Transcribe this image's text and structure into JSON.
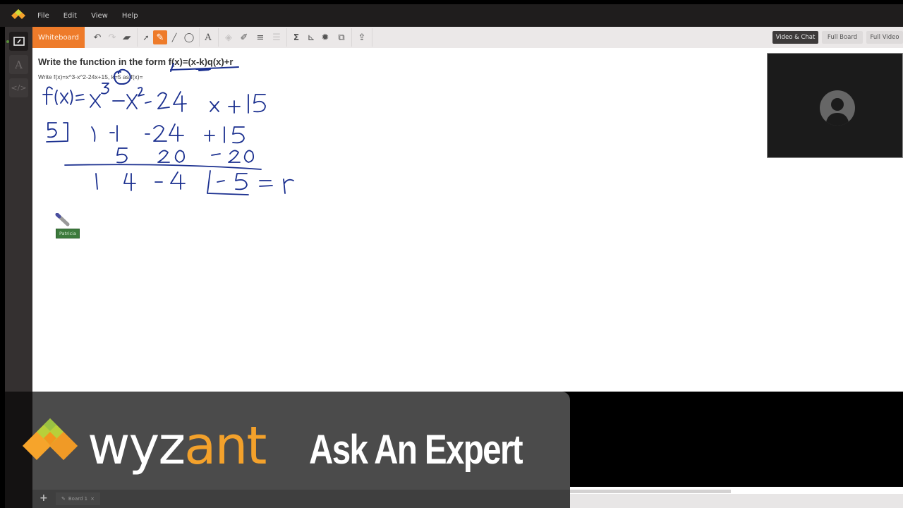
{
  "menu": {
    "items": [
      "File",
      "Edit",
      "View",
      "Help"
    ]
  },
  "toolbar": {
    "active_tab": "Whiteboard",
    "tools": [
      {
        "name": "undo-icon",
        "glyph": "↶",
        "state": "normal"
      },
      {
        "name": "redo-icon",
        "glyph": "↷",
        "state": "disabled"
      },
      {
        "name": "eraser-icon",
        "glyph": "▰",
        "state": "normal"
      },
      {
        "name": "select-icon",
        "glyph": "➚",
        "state": "normal"
      },
      {
        "name": "pen-icon",
        "glyph": "✎",
        "state": "active"
      },
      {
        "name": "line-icon",
        "glyph": "╱",
        "state": "normal"
      },
      {
        "name": "shape-icon",
        "glyph": "◯",
        "state": "normal"
      },
      {
        "name": "text-icon",
        "glyph": "A",
        "state": "normal"
      },
      {
        "name": "fill-icon",
        "glyph": "◈",
        "state": "disabled"
      },
      {
        "name": "color-icon",
        "glyph": "✐",
        "state": "normal"
      },
      {
        "name": "line-weight-icon",
        "glyph": "≡",
        "state": "normal"
      },
      {
        "name": "line-style-icon",
        "glyph": "☰",
        "state": "disabled"
      },
      {
        "name": "equation-icon",
        "glyph": "Σ",
        "state": "normal"
      },
      {
        "name": "graph-icon",
        "glyph": "⊾",
        "state": "normal"
      },
      {
        "name": "settings-icon",
        "glyph": "✹",
        "state": "normal"
      },
      {
        "name": "layers-icon",
        "glyph": "⧉",
        "state": "normal"
      },
      {
        "name": "upload-icon",
        "glyph": "⇪",
        "state": "normal"
      }
    ],
    "view_buttons": [
      {
        "label": "Video & Chat",
        "active": true
      },
      {
        "label": "Full Board",
        "active": false
      },
      {
        "label": "Full Video",
        "active": false
      }
    ]
  },
  "left_rail": {
    "items": [
      {
        "name": "whiteboard-icon",
        "glyph": "✎",
        "active": true
      },
      {
        "name": "text-editor-icon",
        "glyph": "A",
        "active": false
      },
      {
        "name": "code-editor-icon",
        "glyph": "</>",
        "active": false
      }
    ]
  },
  "canvas": {
    "question_title": "Write the function in the form f(x)=(x-k)q(x)+r",
    "question_subtitle": "Write f(x)=x^3-x^2-24x+15, k=5 as f(x)=",
    "handwriting": {
      "line1": "f(x) = x³ − x² − 24x + 15",
      "divisor": "5",
      "row1": [
        "1",
        "-1",
        "-24",
        "+15"
      ],
      "row2": [
        "5",
        "20",
        "-20"
      ],
      "row3": [
        "1",
        "4",
        "-4",
        "-5 = r"
      ]
    },
    "cursor_user": "Patricia",
    "ink_color": "#1a2f8f"
  },
  "video": {
    "state": "no-video"
  },
  "boards": {
    "tabs": [
      {
        "label": "Board 1"
      }
    ],
    "add_label": "+"
  },
  "banner": {
    "brand_part1": "wyz",
    "brand_part2": "ant",
    "tagline": "Ask An Expert",
    "brand_color": "#f3a12b"
  }
}
